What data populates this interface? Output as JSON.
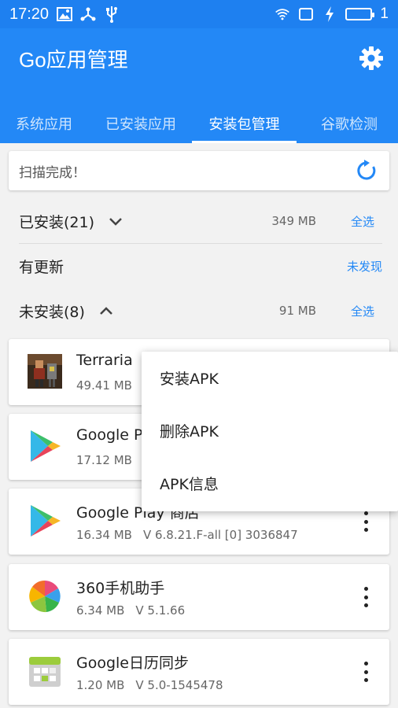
{
  "status_bar": {
    "time": "17:20",
    "battery_level": "1",
    "left_icons": [
      "image-icon",
      "usb-share-icon",
      "usb-icon"
    ],
    "right_icons": [
      "wifi-icon",
      "screen-rotate-icon",
      "charging-bolt-icon",
      "battery-icon"
    ]
  },
  "app_bar": {
    "title": "Go应用管理",
    "background_color": "#2388f6",
    "settings_icon": "gear-icon"
  },
  "tabs": [
    {
      "label": "系统应用",
      "active": false
    },
    {
      "label": "已安装应用",
      "active": false
    },
    {
      "label": "安装包管理",
      "active": true
    },
    {
      "label": "谷歌检测",
      "active": false
    }
  ],
  "scan_status": {
    "text": "扫描完成！",
    "icon": "refresh-icon"
  },
  "sections": {
    "installed": {
      "title": "已安装(21)",
      "size": "349 MB",
      "action": "全选",
      "icon": "chevron-down-icon"
    },
    "updates": {
      "title": "有更新",
      "action": "未发现"
    },
    "not_installed": {
      "title": "未安装(8)",
      "size": "91 MB",
      "action": "全选",
      "icon": "chevron-up-icon"
    }
  },
  "apps": [
    {
      "name": "Terraria",
      "size": "49.41 MB",
      "version": "",
      "icon": "terraria-icon"
    },
    {
      "name": "Google P",
      "size": "17.12 MB",
      "version": "",
      "icon": "google-play-icon"
    },
    {
      "name": "Google Play 商店",
      "size": "16.34 MB",
      "version": "V 6.8.21.F-all [0] 3036847",
      "icon": "google-play-icon"
    },
    {
      "name": "360手机助手",
      "size": "6.34 MB",
      "version": "V 5.1.66",
      "icon": "360-assistant-icon"
    },
    {
      "name": "Google日历同步",
      "size": "1.20 MB",
      "version": "V 5.0-1545478",
      "icon": "google-calendar-sync-icon"
    }
  ],
  "popup_menu": {
    "items": [
      "安装APK",
      "删除APK",
      "APK信息"
    ]
  }
}
